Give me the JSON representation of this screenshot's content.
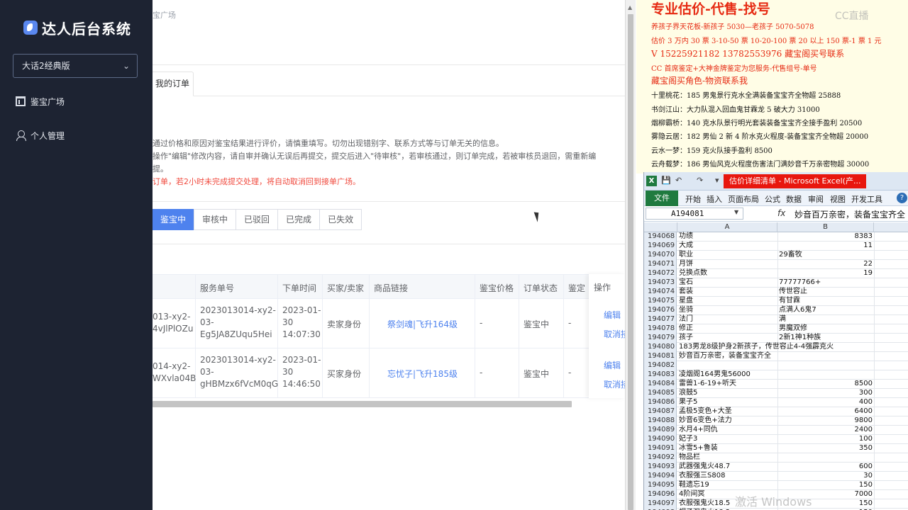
{
  "sidebar": {
    "logo": "达人后台系统",
    "game_select": "大话2经典版",
    "menu": [
      {
        "label": "鉴宝广场"
      },
      {
        "label": "个人管理"
      }
    ]
  },
  "main": {
    "breadcrumb": "宝广场",
    "tab_label": "我的订单",
    "notices": [
      "通过价格和原因对鉴宝结果进行评价，请慎重填写。切勿出现错别字、联系方式等与订单无关的信息。",
      "操作\"编辑\"修改内容，请自审并确认无误后再提交，提交后进入\"待审核\"，若审核通过，则订单完成，若被审核员退回，需重新编",
      "提。",
      "订单，若2小时未完成提交处理，将自动取消回到接单广场。"
    ],
    "status_tabs": [
      "鉴宝中",
      "审核中",
      "已驳回",
      "已完成",
      "已失效"
    ],
    "columns": [
      "服务单号",
      "下单时间",
      "买家/卖家",
      "商品链接",
      "鉴宝价格",
      "订单状态",
      "鉴定",
      "操作"
    ],
    "rows": [
      {
        "partial_id": "013-xy2-\n4vJlPlOZu",
        "service_no": "2023013014-xy2-\n03-\nEg5JA8ZUqu5Hei",
        "time": "2023-01-\n30\n14:07:30",
        "role": "卖家身份",
        "link": "祭剑魂|飞升164级",
        "price": "-",
        "status": "鉴宝中",
        "appraise": "-",
        "edit": "编辑",
        "cancel": "取消接"
      },
      {
        "partial_id": "014-xy2-\nWXvla04B",
        "service_no": "2023013014-xy2-\n03-\ngHBMzx6fVcM0qG",
        "time": "2023-01-\n30\n14:46:50",
        "role": "买家身份",
        "link": "忘忧子|飞升185级",
        "price": "-",
        "status": "鉴宝中",
        "appraise": "-",
        "edit": "编辑",
        "cancel": "取消接"
      }
    ]
  },
  "doc": {
    "watermark": "CC直播",
    "lines": [
      {
        "text": "专业估价-代售-找号",
        "style": "big"
      },
      {
        "text": "养孩子界天花板-新孩子 5030—老孩子 5070-5078",
        "style": "red"
      },
      {
        "text": "估价 3 万内 30 票 3-10-50 票 10-20-100 票 20 以上 150 票-1 票 1 元",
        "style": "red"
      },
      {
        "text": "V 15225921182      13782553976    藏宝阁买号联系",
        "style": "red-m"
      },
      {
        "text": "CC 首席鉴定+大神金牌鉴定为您服务-代售组号-单号",
        "style": "red"
      },
      {
        "text": "藏宝阁买角色-物资联系我",
        "style": "red-m"
      },
      {
        "text": "十里桃花：185 男鬼景行克水全满装备宝宝齐全物超 25888",
        "style": "black"
      },
      {
        "text": "书剑江山：大力队混入回血鬼甘霖龙 5 破大力 31000",
        "style": "black"
      },
      {
        "text": "烟柳霸桥：140 克水队景行明光套装装备宝宝齐全接手盈利 20500",
        "style": "black"
      },
      {
        "text": "雾隐云居：182 男仙 2 新 4 阶水克火程度-装备宝宝齐全物超 20000",
        "style": "black"
      },
      {
        "text": "云水一梦：159 克火队接手盈利 8500",
        "style": "black"
      },
      {
        "text": "云舟载梦：186 男仙风克火程度伤害法门满妙音千万亲密物超 30000",
        "style": "black"
      }
    ]
  },
  "excel": {
    "app_icon": "X",
    "title": "估价详细清单 - Microsoft Excel(产...",
    "file_tab": "文件",
    "ribbon_tabs": [
      "开始",
      "插入",
      "页面布局",
      "公式",
      "数据",
      "审阅",
      "视图",
      "开发工具"
    ],
    "help": "?",
    "name_box": "A194081",
    "fx": "fx",
    "formula": "妙音百万亲密，装备宝宝齐全",
    "col_headers": [
      "A",
      "B"
    ],
    "watermark": "激活 Windows",
    "rows": [
      {
        "n": "194068",
        "a": "功绩",
        "b": "8383"
      },
      {
        "n": "194069",
        "a": "大成",
        "b": "11"
      },
      {
        "n": "194070",
        "a": "职业",
        "b": "29畜牧"
      },
      {
        "n": "194071",
        "a": "月饼",
        "b": "22"
      },
      {
        "n": "194072",
        "a": "兑换点数",
        "b": "19"
      },
      {
        "n": "194073",
        "a": "宝石",
        "b": "77777766+"
      },
      {
        "n": "194074",
        "a": "套装",
        "b": "传世容止"
      },
      {
        "n": "194075",
        "a": "星盘",
        "b": "有甘霖"
      },
      {
        "n": "194076",
        "a": "坐骑",
        "b": "点满人6鬼7"
      },
      {
        "n": "194077",
        "a": "法门",
        "b": "满"
      },
      {
        "n": "194078",
        "a": "修正",
        "b": "男魔双修"
      },
      {
        "n": "194079",
        "a": "孩子",
        "b": "2新1神1种族"
      },
      {
        "n": "194080",
        "a": "183男龙8级护身2新孩子，传世容止4-4强霹克火",
        "b": ""
      },
      {
        "n": "194081",
        "a": "妙音百万亲密，装备宝宝齐全",
        "b": ""
      },
      {
        "n": "194082",
        "a": "",
        "b": ""
      },
      {
        "n": "194083",
        "a": "凌烟阁164男鬼56000",
        "b": ""
      },
      {
        "n": "194084",
        "a": "雷兽1-6-19+听天",
        "b": "8500"
      },
      {
        "n": "194085",
        "a": "浪鼓5",
        "b": "300"
      },
      {
        "n": "194086",
        "a": "果子5",
        "b": "400"
      },
      {
        "n": "194087",
        "a": "孟极5变色+大圣",
        "b": "6400"
      },
      {
        "n": "194088",
        "a": "妙音6变色+法力",
        "b": "9800"
      },
      {
        "n": "194089",
        "a": "水月4+同仇",
        "b": "2400"
      },
      {
        "n": "194090",
        "a": "妃子3",
        "b": "100"
      },
      {
        "n": "194091",
        "a": "冰雪5+鲁装",
        "b": "350"
      },
      {
        "n": "194092",
        "a": "物品栏",
        "b": ""
      },
      {
        "n": "194093",
        "a": "武器强鬼火48.7",
        "b": "600"
      },
      {
        "n": "194094",
        "a": "衣服强三S808",
        "b": "30"
      },
      {
        "n": "194095",
        "a": "鞋遗忘19",
        "b": "150"
      },
      {
        "n": "194096",
        "a": "4阶间冥",
        "b": "7000"
      },
      {
        "n": "194097",
        "a": "衣服强鬼火18.5",
        "b": "150"
      },
      {
        "n": "194098",
        "a": "帽子强鬼火18.2",
        "b": "150"
      }
    ]
  }
}
